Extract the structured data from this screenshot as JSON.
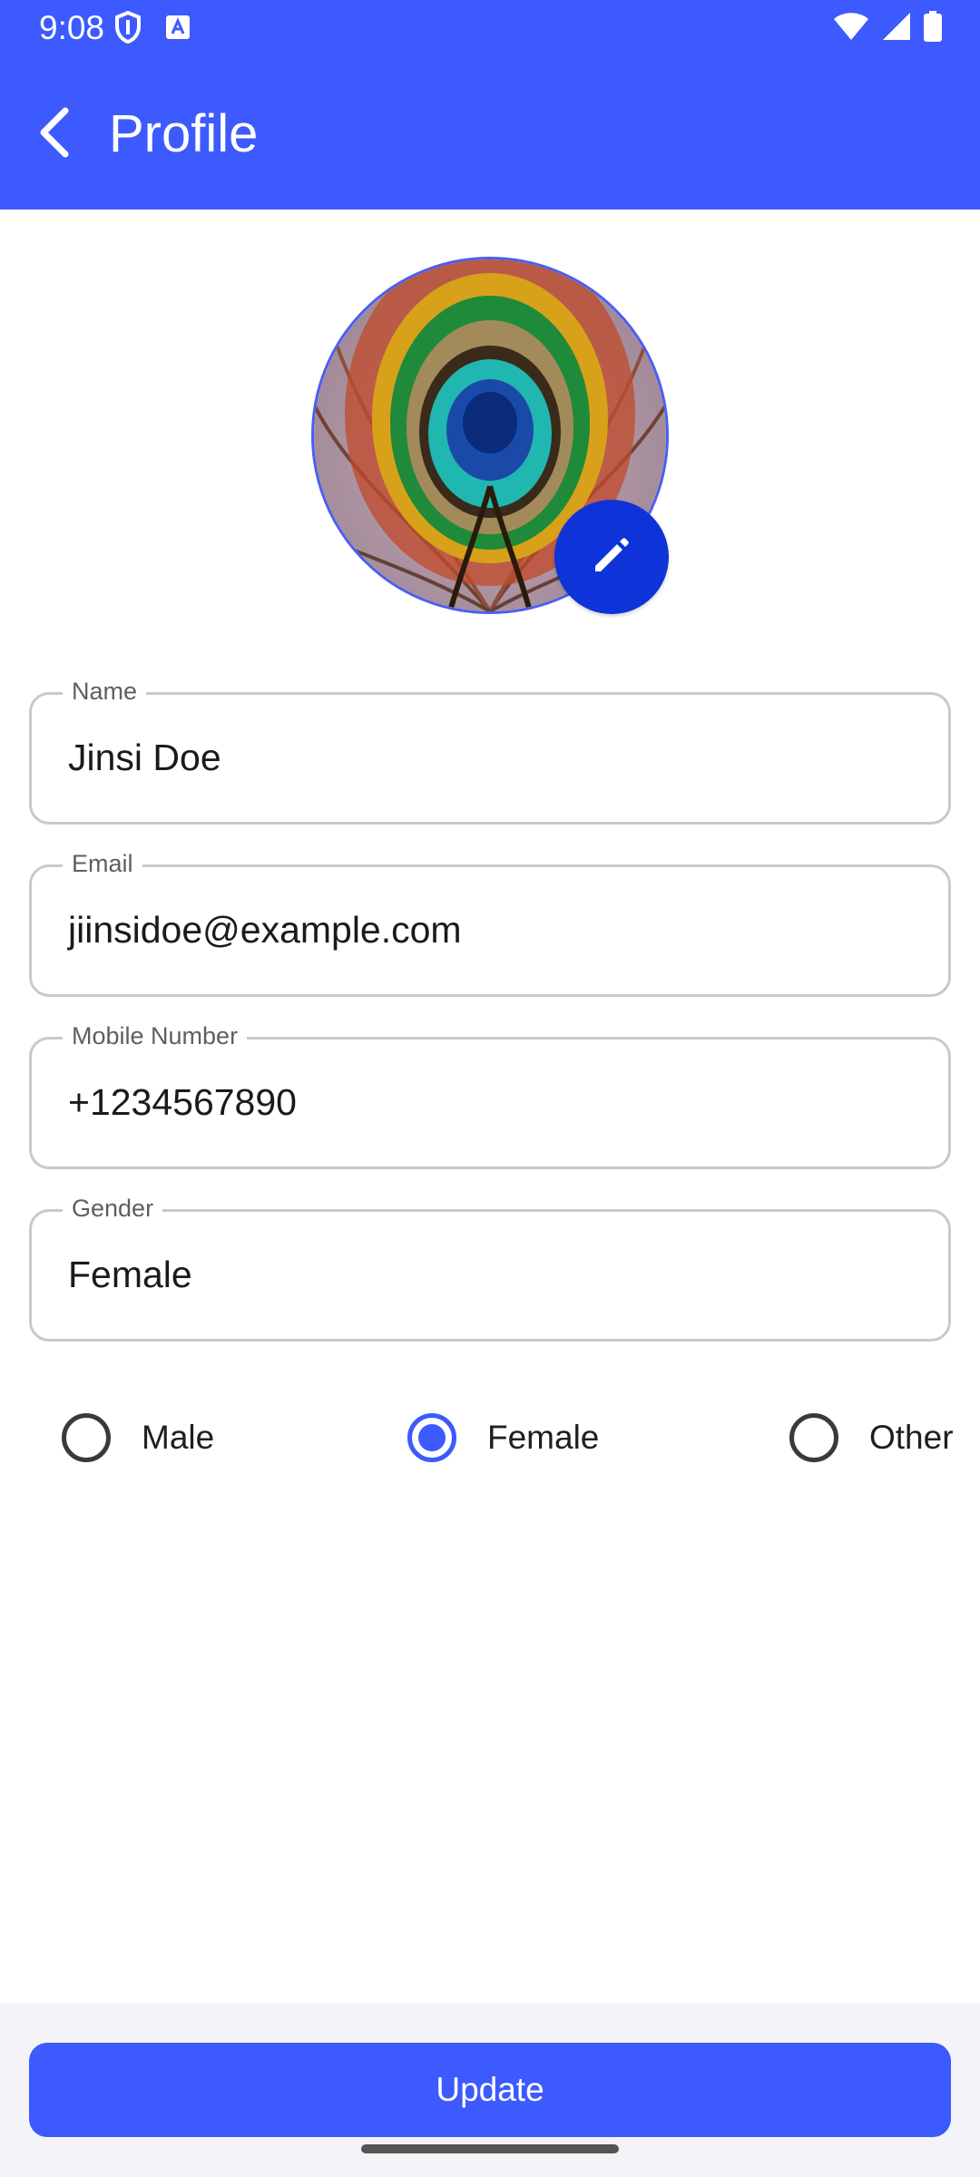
{
  "status_bar": {
    "time": "9:08",
    "left_icons": [
      "shield-icon",
      "text-notification-icon"
    ],
    "right_icons": [
      "wifi-icon",
      "cellular-signal-icon",
      "battery-icon"
    ]
  },
  "header": {
    "title": "Profile",
    "back_icon": "chevron-left-icon",
    "background": "#3d5afe"
  },
  "avatar": {
    "image": "peacock-feather",
    "edit_icon": "pencil-icon"
  },
  "fields": {
    "name": {
      "label": "Name",
      "value": "Jinsi Doe"
    },
    "email": {
      "label": "Email",
      "value": "jiinsidoe@example.com"
    },
    "mobile": {
      "label": "Mobile Number",
      "value": "+1234567890"
    },
    "gender": {
      "label": "Gender",
      "value": "Female"
    }
  },
  "gender_options": [
    {
      "label": "Male",
      "checked": false
    },
    {
      "label": "Female",
      "checked": true
    },
    {
      "label": "Other",
      "checked": false
    }
  ],
  "actions": {
    "update_label": "Update"
  },
  "colors": {
    "accent": "#3d5afe",
    "edit_button": "#0d33d9"
  }
}
